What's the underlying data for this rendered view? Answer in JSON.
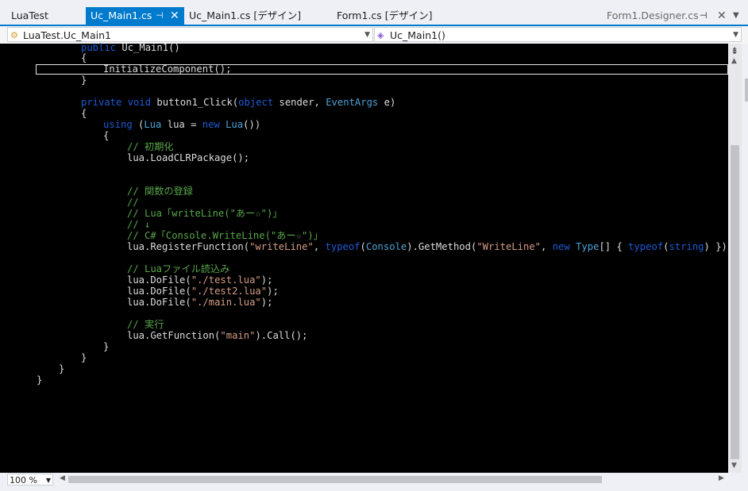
{
  "tabs": {
    "project": "LuaTest",
    "active": "Uc_Main1.cs",
    "tab2": "Uc_Main1.cs [デザイン]",
    "tab3": "Form1.cs [デザイン]",
    "right": "Form1.Designer.cs"
  },
  "nav": {
    "class_combo": "LuaTest.Uc_Main1",
    "member_combo": "Uc_Main1()"
  },
  "zoom": "100 %",
  "colors": {
    "accent": "#007acc",
    "keyword": "#1c5bd6",
    "type": "#4ea3d6",
    "comment": "#57a64a",
    "string": "#d69d85",
    "change_marker": "#57a64a"
  },
  "code": {
    "l01_kw": "public",
    "l01_rest": " Uc_Main1()",
    "l02": "{",
    "l03": "InitializeComponent();",
    "l04": "}",
    "l05_kw1": "private",
    "l05_kw2": "void",
    "l05_name": " button1_Click(",
    "l05_kw3": "object",
    "l05_mid": " sender, ",
    "l05_ty": "EventArgs",
    "l05_end": " e)",
    "l06": "{",
    "l07_kw": "using",
    "l07_a": " (",
    "l07_ty1": "Lua",
    "l07_b": " lua = ",
    "l07_kw2": "new",
    "l07_sp": " ",
    "l07_ty2": "Lua",
    "l07_c": "())",
    "l08": "{",
    "l09": "// 初期化",
    "l10": "lua.LoadCLRPackage();",
    "l11": "// 関数の登録",
    "l12": "//",
    "l13": "// Lua「writeLine(\"あー☆\")」",
    "l14": "// ↓",
    "l15": "// C#「Console.WriteLine(\"あー☆\")」",
    "l16_a": "lua.RegisterFunction(",
    "l16_s1": "\"writeLine\"",
    "l16_b": ", ",
    "l16_kw1": "typeof",
    "l16_c": "(",
    "l16_ty1": "Console",
    "l16_d": ").GetMethod(",
    "l16_s2": "\"WriteLine\"",
    "l16_e": ", ",
    "l16_kw2": "new",
    "l16_f": " ",
    "l16_ty2": "Type",
    "l16_g": "[] { ",
    "l16_kw3": "typeof",
    "l16_h": "(",
    "l16_kw4": "string",
    "l16_i": ") }));",
    "l17": "// Luaファイル読込み",
    "l18_a": "lua.DoFile(",
    "l18_s": "\"./test.lua\"",
    "l18_b": ");",
    "l19_a": "lua.DoFile(",
    "l19_s": "\"./test2.lua\"",
    "l19_b": ");",
    "l20_a": "lua.DoFile(",
    "l20_s": "\"./main.lua\"",
    "l20_b": ");",
    "l21": "// 実行",
    "l22_a": "lua.GetFunction(",
    "l22_s": "\"main\"",
    "l22_b": ").Call();",
    "l23": "}",
    "l24": "}",
    "l25": "}",
    "l26": "}"
  }
}
